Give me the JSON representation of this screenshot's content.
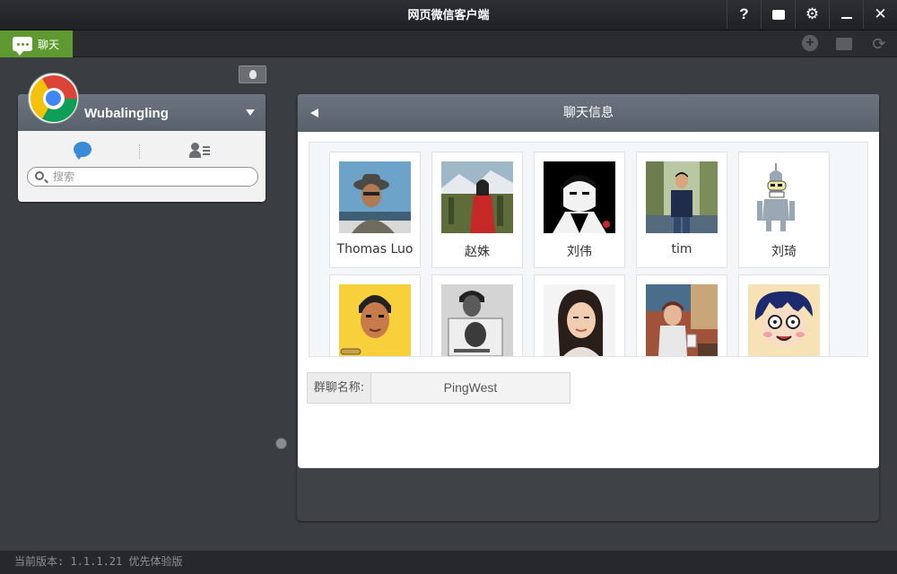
{
  "window": {
    "title": "网页微信客户端",
    "buttons": [
      "?",
      "feedback",
      "settings",
      "minimize",
      "close"
    ]
  },
  "tabbar": {
    "chat_tab_label": "聊天",
    "tools": [
      "add-icon",
      "folder-icon",
      "refresh-icon"
    ]
  },
  "sidebar": {
    "username": "Wubalingling",
    "search_placeholder": "搜索",
    "avatar": "chrome-logo"
  },
  "chat_info": {
    "title": "聊天信息",
    "members": [
      {
        "name": "Thomas Luo",
        "photo": "man-with-hat"
      },
      {
        "name": "赵姝",
        "photo": "woman-red-coat"
      },
      {
        "name": "刘伟",
        "photo": "godfather-poster"
      },
      {
        "name": "tim",
        "photo": "man-outdoors"
      },
      {
        "name": "刘琦",
        "photo": "bender-robot"
      },
      {
        "name": "",
        "photo": "cartoon-man-yellow"
      },
      {
        "name": "",
        "photo": "bw-man-paper"
      },
      {
        "name": "",
        "photo": "young-woman"
      },
      {
        "name": "",
        "photo": "woman-cafe"
      },
      {
        "name": "",
        "photo": "cartoon-glasses"
      }
    ],
    "group_name_label": "群聊名称:",
    "group_name_value": "PingWest"
  },
  "footer": {
    "version_text": "当前版本: 1.1.1.21 优先体验版"
  }
}
